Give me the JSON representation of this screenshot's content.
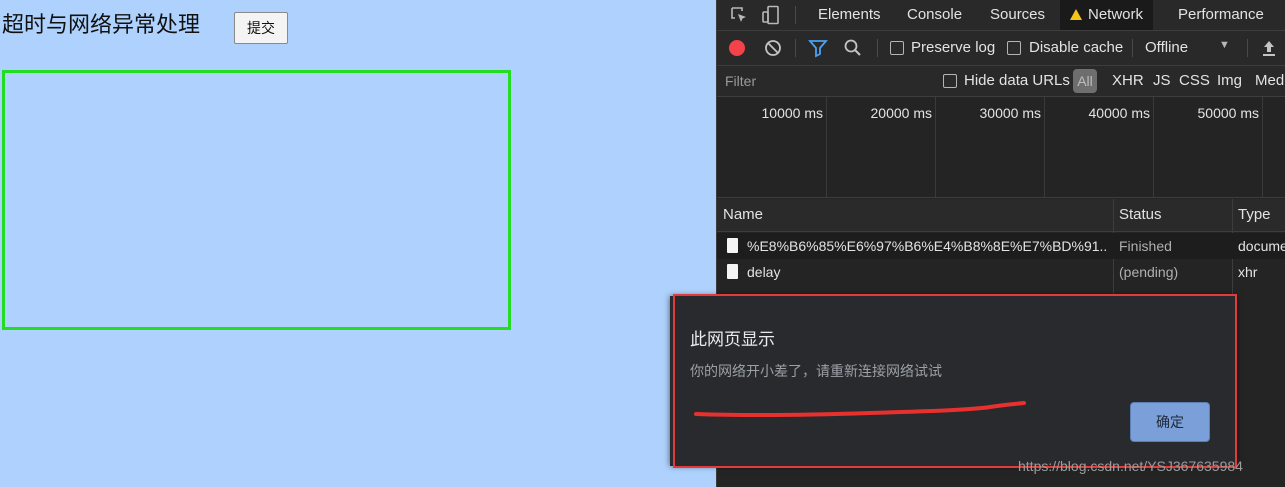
{
  "page": {
    "title": "超时与网络异常处理",
    "submit_label": "提交"
  },
  "devtools": {
    "tabs": [
      {
        "label": "Elements"
      },
      {
        "label": "Console"
      },
      {
        "label": "Sources"
      },
      {
        "label": "Network"
      },
      {
        "label": "Performance"
      }
    ],
    "toolbar": {
      "preserve_log": "Preserve log",
      "disable_cache": "Disable cache",
      "throttle": "Offline"
    },
    "filter": {
      "placeholder": "Filter",
      "hide_data_urls": "Hide data URLs",
      "types": [
        "All",
        "XHR",
        "JS",
        "CSS",
        "Img",
        "Med"
      ]
    },
    "timeline": {
      "ticks": [
        "10000 ms",
        "20000 ms",
        "30000 ms",
        "40000 ms",
        "50000 ms"
      ]
    },
    "table": {
      "headers": {
        "name": "Name",
        "status": "Status",
        "type": "Type"
      },
      "rows": [
        {
          "name": "%E8%B6%85%E6%97%B6%E4%B8%8E%E7%BD%91...",
          "status": "Finished",
          "type": "docume"
        },
        {
          "name": "delay",
          "status": "(pending)",
          "type": "xhr"
        }
      ]
    }
  },
  "dialog": {
    "title": "此网页显示",
    "message": "你的网络开小差了，请重新连接网络试试",
    "ok_label": "确定"
  },
  "watermark": "https://blog.csdn.net/YSJ367635984"
}
